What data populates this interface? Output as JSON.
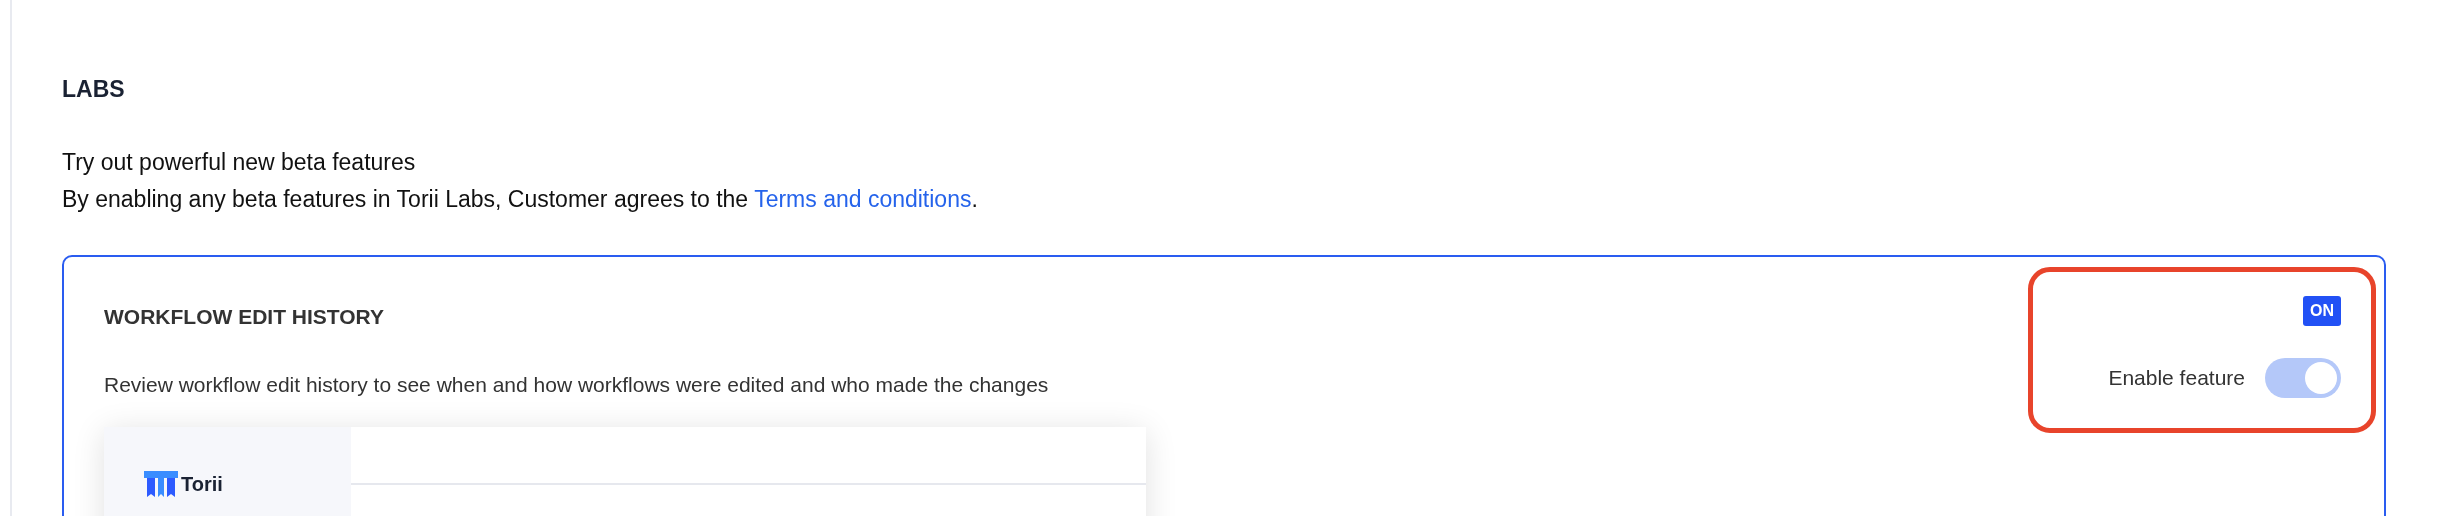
{
  "section": {
    "title": "LABS",
    "intro": "Try out powerful new beta features",
    "terms_text": "By enabling any beta features in Torii Labs, Customer agrees to the ",
    "terms_link": "Terms and conditions",
    "terms_end": "."
  },
  "feature": {
    "title": "WORKFLOW EDIT HISTORY",
    "description": "Review workflow edit history to see when and how workflows were edited and who made the changes",
    "status_badge": "ON",
    "toggle_label": "Enable feature",
    "enabled": true,
    "preview": {
      "logo_text": "Torii"
    }
  }
}
